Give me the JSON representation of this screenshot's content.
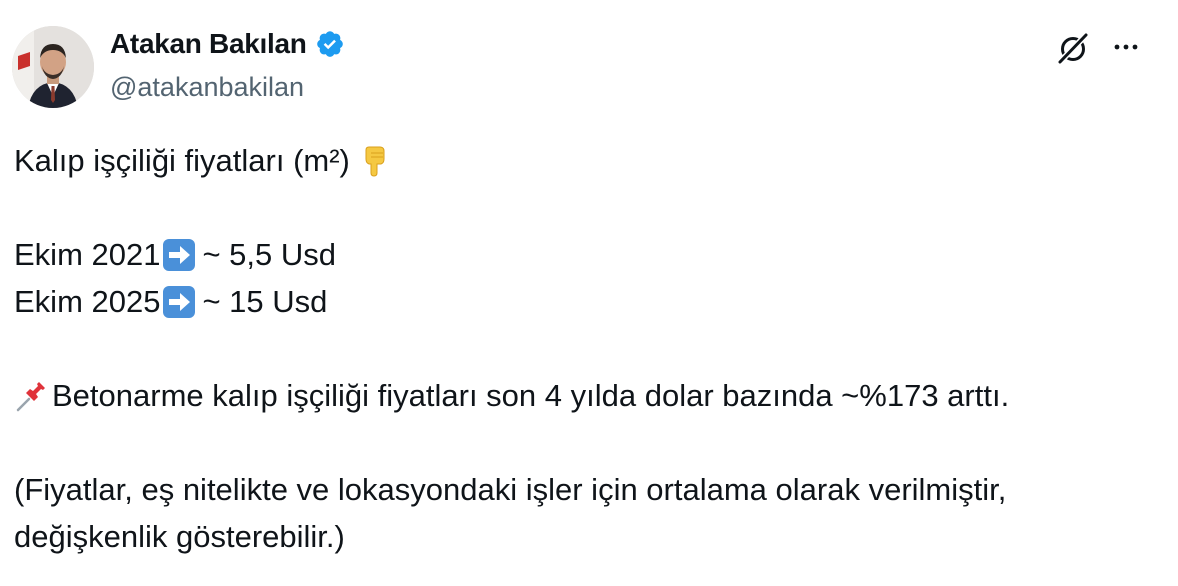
{
  "tweet": {
    "author": {
      "display_name": "Atakan Bakılan",
      "handle": "@atakanbakilan",
      "verified_icon": "verified-badge-icon"
    },
    "header_actions": {
      "grok_icon": "grok-icon",
      "more_icon": "more-horizontal-icon"
    },
    "body": {
      "line1": "Kalıp işçiliği fiyatları (m²)",
      "line1_emoji": "backhand-index-pointing-down",
      "line2_label": "Ekim 2021",
      "line2_value": " ~ 5,5 Usd",
      "line3_label": "Ekim 2025",
      "line3_value": " ~ 15 Usd",
      "arrow_emoji": "right-arrow",
      "pin_emoji": "pushpin",
      "line4": "Betonarme kalıp işçiliği fiyatları son 4 yılda dolar bazında ~%173 arttı.",
      "line5": "(Fiyatlar, eş nitelikte ve lokasyondaki işler için ortalama olarak verilmiştir,",
      "line6": "değişkenlik gösterebilir.)"
    },
    "colors": {
      "text": "#0f1419",
      "secondary": "#536471",
      "verified": "#1d9bf0",
      "arrow_tile": "#4a90d9"
    }
  }
}
